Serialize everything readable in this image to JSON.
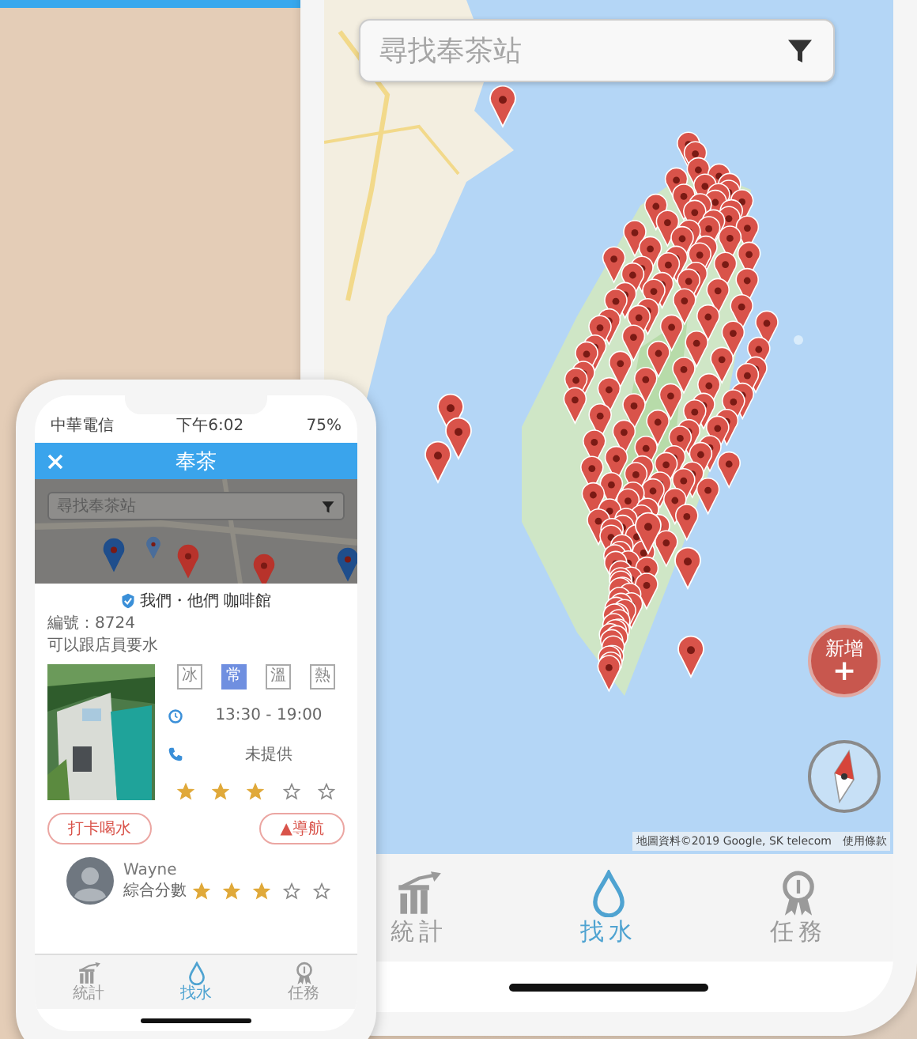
{
  "main_screen": {
    "search": {
      "placeholder": "尋找奉茶站"
    },
    "add_button": {
      "label": "新增",
      "symbol": "+"
    },
    "attribution": "地圖資料©2019 Google, SK telecom　使用條款",
    "tabs": [
      {
        "label": "統計",
        "selected": false
      },
      {
        "label": "找水",
        "selected": true
      },
      {
        "label": "任務",
        "selected": false
      }
    ]
  },
  "detail_screen": {
    "status_bar": {
      "carrier": "中華電信",
      "time": "下午6:02",
      "battery": "75%"
    },
    "header": {
      "title": "奉茶"
    },
    "search": {
      "placeholder": "尋找奉茶站"
    },
    "place": {
      "name": "我們・他們 咖啡館",
      "verified": true,
      "number": "編號：8724",
      "note": "可以跟店員要水",
      "temperatures": [
        {
          "label": "冰",
          "selected": false
        },
        {
          "label": "常",
          "selected": true
        },
        {
          "label": "溫",
          "selected": false
        },
        {
          "label": "熱",
          "selected": false
        }
      ],
      "hours": "13:30 - 19:00",
      "phone": "未提供",
      "stars": 3
    },
    "actions": [
      {
        "label": "打卡喝水"
      },
      {
        "label": "▲導航"
      }
    ],
    "review": {
      "user": "Wayne",
      "score_label": "綜合分數",
      "stars": 3
    },
    "tabs": [
      {
        "label": "統計",
        "selected": false
      },
      {
        "label": "找水",
        "selected": true
      },
      {
        "label": "任務",
        "selected": false
      }
    ]
  }
}
